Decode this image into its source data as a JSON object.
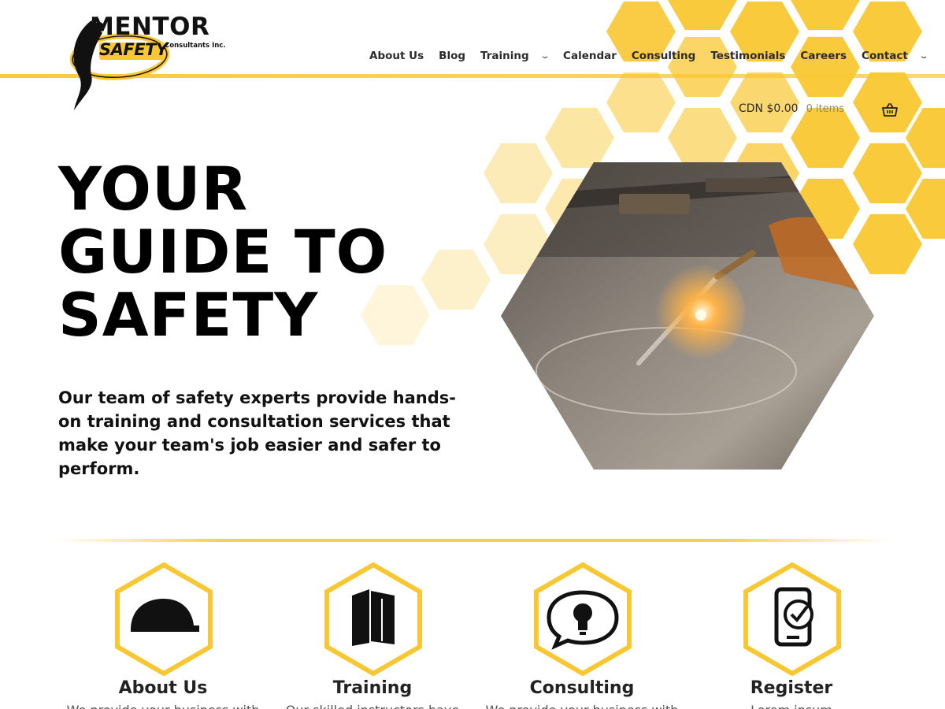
{
  "brand": {
    "name_top": "MENTOR",
    "name_mid": "SAFETY",
    "name_sub": "Consultants Inc.",
    "accent": "#F9C732",
    "dark": "#111111"
  },
  "nav": {
    "items": [
      {
        "label": "About Us",
        "has_dropdown": false
      },
      {
        "label": "Blog",
        "has_dropdown": false
      },
      {
        "label": "Training",
        "has_dropdown": true
      },
      {
        "label": "Calendar",
        "has_dropdown": false
      },
      {
        "label": "Consulting",
        "has_dropdown": false
      },
      {
        "label": "Testimonials",
        "has_dropdown": false
      },
      {
        "label": "Careers",
        "has_dropdown": false
      },
      {
        "label": "Contact",
        "has_dropdown": true
      }
    ]
  },
  "cart": {
    "amount": "CDN $0.00",
    "items": "0 items",
    "icon": "basket-icon"
  },
  "hero": {
    "title_lines": [
      "YOUR",
      "GUIDE TO",
      "SAFETY"
    ],
    "description": "Our team of safety experts provide hands-on training and consultation services that make your team's job easier and safer to perform.",
    "image": "welding-torch-photo"
  },
  "features": [
    {
      "title": "About Us",
      "text": "We provide your business with",
      "icon": "hard-hat-icon"
    },
    {
      "title": "Training",
      "text": "Our skilled instructors have",
      "icon": "books-icon"
    },
    {
      "title": "Consulting",
      "text": "We provide your business with",
      "icon": "lightbulb-speech-icon"
    },
    {
      "title": "Register",
      "text": "Lorem ipsum",
      "icon": "phone-check-icon"
    }
  ]
}
